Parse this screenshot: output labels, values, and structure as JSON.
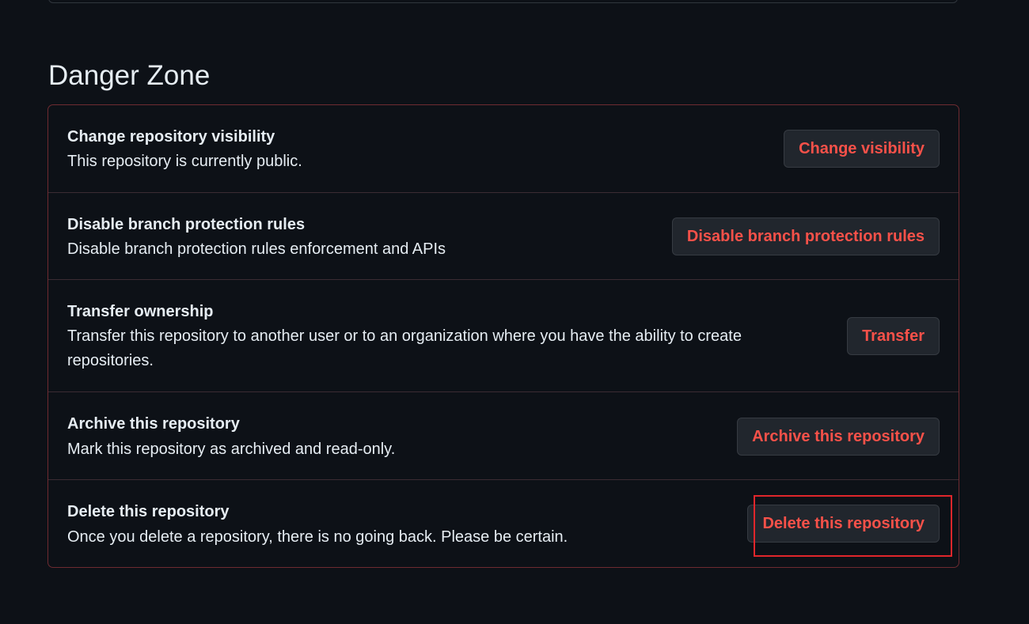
{
  "section": {
    "title": "Danger Zone"
  },
  "rows": [
    {
      "title": "Change repository visibility",
      "description": "This repository is currently public.",
      "button": "Change visibility"
    },
    {
      "title": "Disable branch protection rules",
      "description": "Disable branch protection rules enforcement and APIs",
      "button": "Disable branch protection rules"
    },
    {
      "title": "Transfer ownership",
      "description": "Transfer this repository to another user or to an organization where you have the ability to create repositories.",
      "button": "Transfer"
    },
    {
      "title": "Archive this repository",
      "description": "Mark this repository as archived and read-only.",
      "button": "Archive this repository"
    },
    {
      "title": "Delete this repository",
      "description": "Once you delete a repository, there is no going back. Please be certain.",
      "button": "Delete this repository"
    }
  ],
  "colors": {
    "background": "#0d1117",
    "danger_text": "#f85149",
    "danger_border": "#6e2b31",
    "button_background": "#21262d",
    "highlight_outline": "#e0262b"
  }
}
